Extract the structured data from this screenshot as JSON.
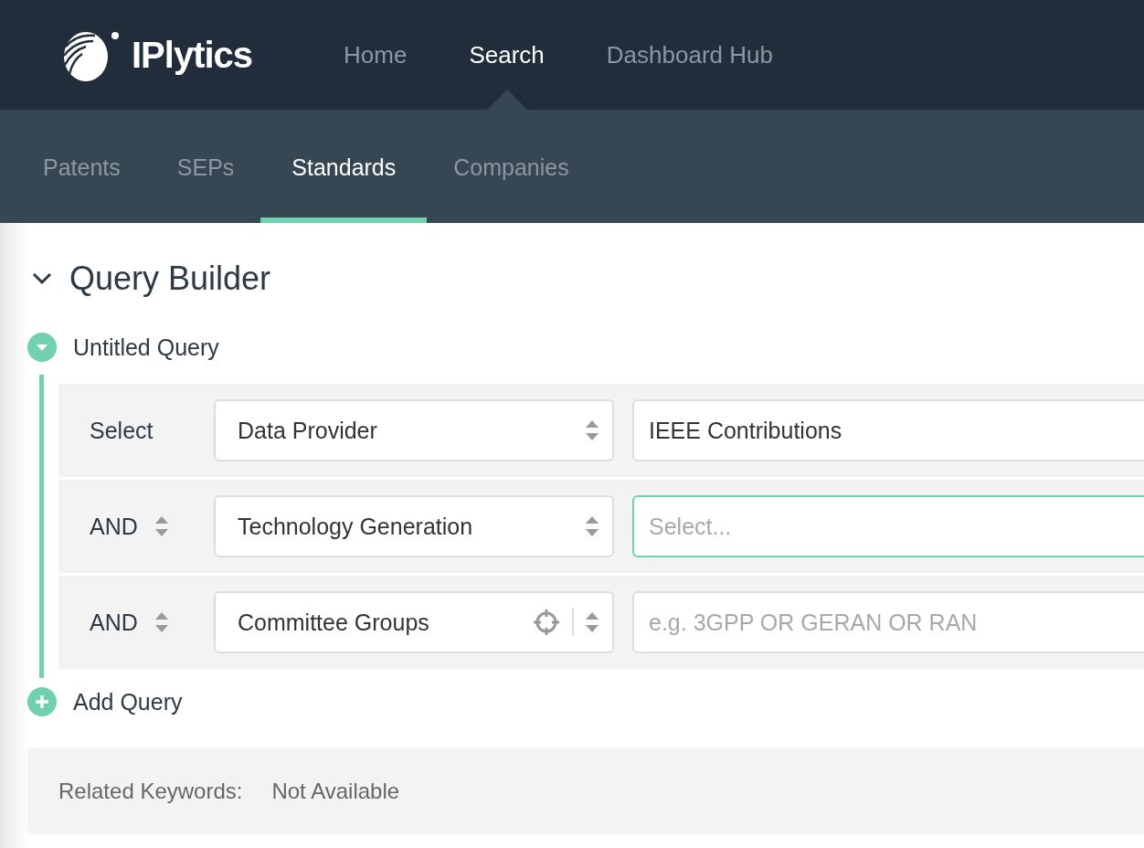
{
  "header": {
    "logo_text": "IPlytics",
    "nav": [
      {
        "label": "Home",
        "selected": false
      },
      {
        "label": "Search",
        "selected": true
      },
      {
        "label": "Dashboard Hub",
        "selected": false
      }
    ]
  },
  "subnav": [
    {
      "label": "Patents",
      "selected": false
    },
    {
      "label": "SEPs",
      "selected": false
    },
    {
      "label": "Standards",
      "selected": true
    },
    {
      "label": "Companies",
      "selected": false
    }
  ],
  "query_builder": {
    "title": "Query Builder",
    "expanded": true,
    "query": {
      "title": "Untitled Query",
      "expanded": true,
      "rows": [
        {
          "kind": "first",
          "operator": "Select",
          "field": "Data Provider",
          "locator": false,
          "value": "IEEE Contributions",
          "focused": false
        },
        {
          "kind": "conjunction",
          "operator": "AND",
          "field": "Technology Generation",
          "locator": false,
          "placeholder": "Select...",
          "focused": true
        },
        {
          "kind": "conjunction",
          "operator": "AND",
          "field": "Committee Groups",
          "locator": true,
          "placeholder": "e.g. 3GPP OR GERAN OR RAN",
          "focused": false
        }
      ]
    },
    "add_query": "Add Query",
    "related": {
      "label": "Related Keywords:",
      "value": "Not Available"
    }
  }
}
